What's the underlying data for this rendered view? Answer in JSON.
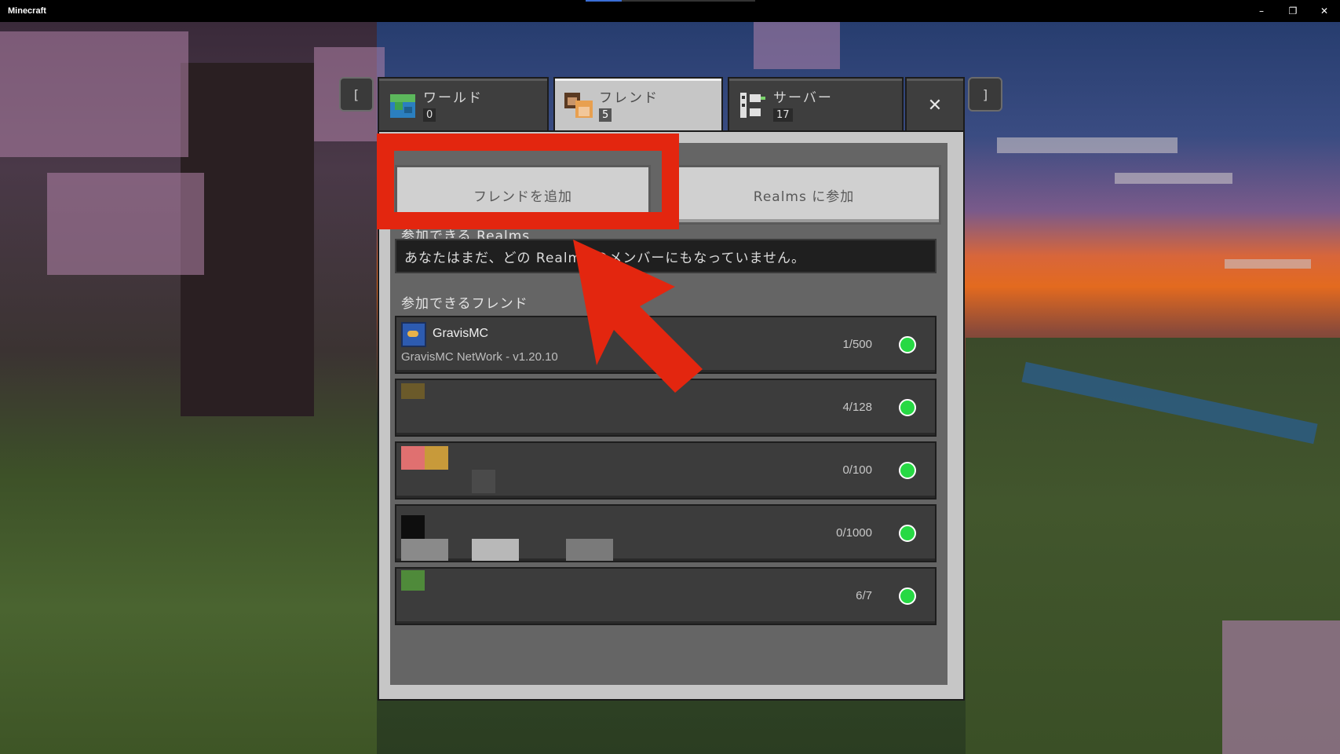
{
  "window": {
    "title": "Minecraft",
    "controls": [
      "–",
      "❐",
      "✕"
    ]
  },
  "nav": {
    "bracket_left": "[",
    "bracket_right": "]"
  },
  "tabs": [
    {
      "label": "ワールド",
      "count": "0",
      "icon": "globe-icon",
      "active": false
    },
    {
      "label": "フレンド",
      "count": "5",
      "icon": "friends-icon",
      "active": true
    },
    {
      "label": "サーバー",
      "count": "17",
      "icon": "server-icon",
      "active": false
    }
  ],
  "close_label": "✕",
  "actions": {
    "add_friend": "フレンドを追加",
    "join_realm": "Realms に参加"
  },
  "realms": {
    "heading": "参加できる Realms",
    "message": "あなたはまだ、どの Realms のメンバーにもなっていません。"
  },
  "friends": {
    "heading": "参加できるフレンド",
    "servers": [
      {
        "name": "GravisMC",
        "motd": "GravisMC NetWork - v1.20.10",
        "players": "1/500",
        "online": true
      },
      {
        "name": "",
        "motd": "",
        "players": "4/128",
        "online": true
      },
      {
        "name": "",
        "motd": "",
        "players": "0/100",
        "online": true
      },
      {
        "name": "",
        "motd": "",
        "players": "0/1000",
        "online": true
      },
      {
        "name": "",
        "motd": "",
        "players": "6/7",
        "online": true
      }
    ]
  },
  "colors": {
    "annotation_red": "#e3260f",
    "online_green": "#27d944"
  }
}
